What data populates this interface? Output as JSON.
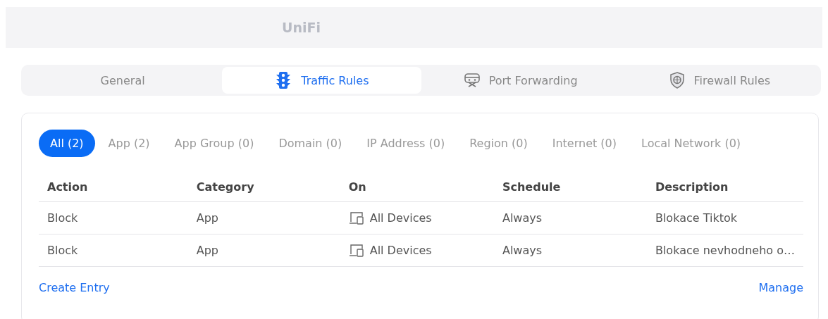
{
  "header": {
    "logo": "UniFi"
  },
  "tabs": [
    {
      "label": "General",
      "selected": false
    },
    {
      "label": "Traffic Rules",
      "selected": true
    },
    {
      "label": "Port Forwarding",
      "selected": false
    },
    {
      "label": "Firewall Rules",
      "selected": false
    }
  ],
  "filters": [
    {
      "label": "All (2)",
      "selected": true
    },
    {
      "label": "App (2)",
      "selected": false
    },
    {
      "label": "App Group (0)",
      "selected": false
    },
    {
      "label": "Domain (0)",
      "selected": false
    },
    {
      "label": "IP Address (0)",
      "selected": false
    },
    {
      "label": "Region (0)",
      "selected": false
    },
    {
      "label": "Internet (0)",
      "selected": false
    },
    {
      "label": "Local Network (0)",
      "selected": false
    }
  ],
  "table": {
    "columns": [
      "Action",
      "Category",
      "On",
      "Schedule",
      "Description"
    ],
    "rows": [
      [
        "Block",
        "App",
        "All Devices",
        "Always",
        "Blokace Tiktok"
      ],
      [
        "Block",
        "App",
        "All Devices",
        "Always",
        "Blokace nevhodneho o…"
      ]
    ]
  },
  "footer": {
    "create": "Create Entry",
    "manage": "Manage"
  }
}
